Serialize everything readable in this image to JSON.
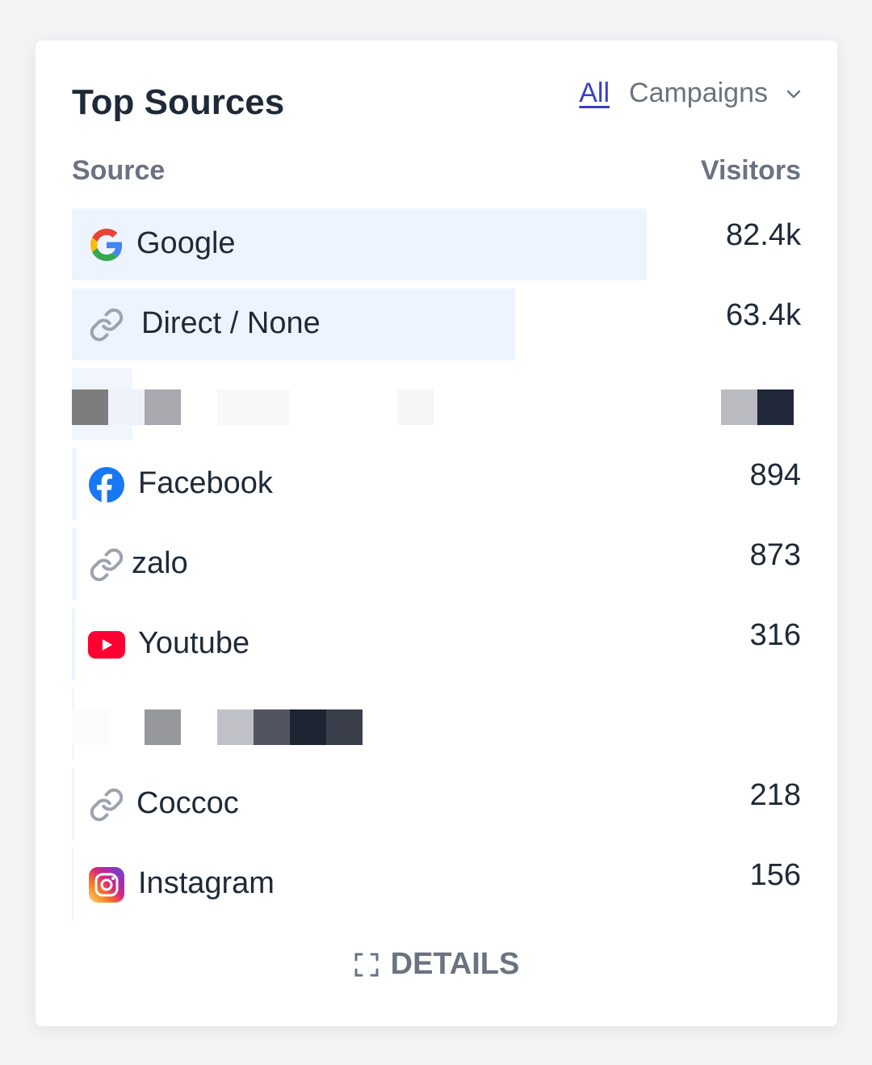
{
  "card": {
    "title": "Top Sources",
    "tabs": {
      "all": "All",
      "campaigns": "Campaigns"
    },
    "columns": {
      "source": "Source",
      "visitors": "Visitors"
    }
  },
  "rows": [
    {
      "icon": "google-icon",
      "label": "Google",
      "value": "82.4k",
      "bar_fraction": 0.79
    },
    {
      "icon": "link-icon",
      "label": "Direct / None",
      "value": "63.4k",
      "bar_fraction": 0.61
    },
    {
      "redacted": true
    },
    {
      "icon": "facebook-icon",
      "label": "Facebook",
      "value": "894"
    },
    {
      "icon": "link-icon",
      "label": "zalo",
      "value": "873"
    },
    {
      "icon": "youtube-icon",
      "label": "Youtube",
      "value": "316"
    },
    {
      "redacted": true
    },
    {
      "icon": "link-icon",
      "label": "Coccoc",
      "value": "218"
    },
    {
      "icon": "instagram-icon",
      "label": "Instagram",
      "value": "156"
    }
  ],
  "footer": {
    "details_label": "DETAILS"
  },
  "colors": {
    "accent": "#3b3fc4",
    "bar": "#eef4ff",
    "text": "#1f2937",
    "muted": "#6b7280"
  }
}
